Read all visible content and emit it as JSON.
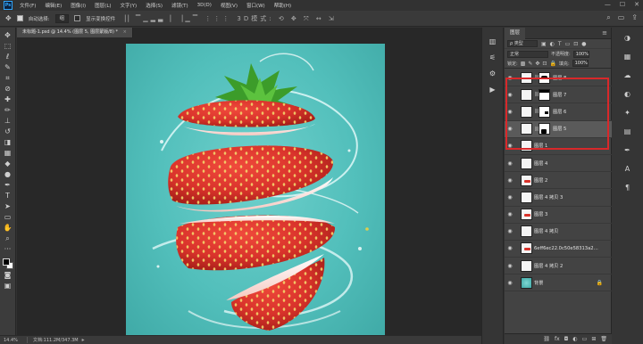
{
  "app": {
    "logo": "Ps"
  },
  "menu": [
    "文件(F)",
    "编辑(E)",
    "图像(I)",
    "图层(L)",
    "文字(Y)",
    "选择(S)",
    "滤镜(T)",
    "3D(D)",
    "视图(V)",
    "窗口(W)",
    "帮助(H)"
  ],
  "window_controls": [
    "—",
    "☐",
    "✕"
  ],
  "options_bar": {
    "auto_select_label": "自动选择:",
    "auto_select_value": "组",
    "show_transform_label": "显示变换控件"
  },
  "tools": [
    "move-icon",
    "marquee-icon",
    "lasso-icon",
    "quick-select-icon",
    "crop-icon",
    "eyedropper-icon",
    "healing-icon",
    "brush-icon",
    "stamp-icon",
    "history-brush-icon",
    "eraser-icon",
    "gradient-icon",
    "blur-icon",
    "dodge-icon",
    "pen-icon",
    "type-icon",
    "path-select-icon",
    "shape-icon",
    "hand-icon",
    "zoom-icon",
    "more-icon"
  ],
  "document_tabs": [
    {
      "title": "未标题-1.psd @ 14.4% (图层 5, 图层蒙版/8) *",
      "active": false
    },
    {
      "title": "",
      "active": true
    }
  ],
  "status_bar": {
    "zoom": "14.4%",
    "doc_info": "文档:111.2M/347.3M"
  },
  "layers_panel": {
    "tab_label": "图层",
    "kind_label": "ρ 类型",
    "blend_mode": "正常",
    "opacity_label": "不透明度:",
    "opacity_value": "100%",
    "lock_label": "锁定:",
    "fill_label": "填充:",
    "fill_value": "100%",
    "layers": [
      {
        "name": "图层 8",
        "thumb": "white",
        "mask": "top-left-black",
        "selected": false,
        "locked": false
      },
      {
        "name": "图层 7",
        "thumb": "white",
        "mask": "top-black",
        "selected": false,
        "locked": false
      },
      {
        "name": "图层 6",
        "thumb": "white",
        "mask": "right-black",
        "selected": false,
        "locked": false
      },
      {
        "name": "图层 5",
        "thumb": "white",
        "mask": "bottom-left-black",
        "selected": true,
        "locked": false
      },
      {
        "name": "图层 1",
        "thumb": "strawberry",
        "mask": "",
        "selected": false,
        "locked": false
      },
      {
        "name": "图层 4",
        "thumb": "strawberry",
        "mask": "",
        "selected": false,
        "locked": false
      },
      {
        "name": "图层 2",
        "thumb": "strawberry",
        "mask": "",
        "selected": false,
        "locked": false
      },
      {
        "name": "图层 4 拷贝 3",
        "thumb": "strawberry",
        "mask": "",
        "selected": false,
        "locked": false
      },
      {
        "name": "图层 3",
        "thumb": "strawberry",
        "mask": "",
        "selected": false,
        "locked": false
      },
      {
        "name": "图层 4 拷贝",
        "thumb": "strawberry",
        "mask": "",
        "selected": false,
        "locked": false
      },
      {
        "name": "6eff6ec22.0c50e58313a22...",
        "thumb": "strawberry",
        "mask": "",
        "selected": false,
        "locked": false
      },
      {
        "name": "图层 4 拷贝 2",
        "thumb": "strawberry",
        "mask": "",
        "selected": false,
        "locked": false
      },
      {
        "name": "背景",
        "thumb": "teal",
        "mask": "",
        "selected": false,
        "locked": true
      }
    ],
    "footer_icons": [
      "link-layers-icon",
      "fx-icon",
      "add-mask-icon",
      "adjustment-icon",
      "group-icon",
      "new-layer-icon",
      "delete-icon"
    ]
  },
  "colors": {
    "highlight": "#d8282a",
    "canvas_teal": "#52bfbb",
    "strawberry_red": "#d9332b"
  }
}
